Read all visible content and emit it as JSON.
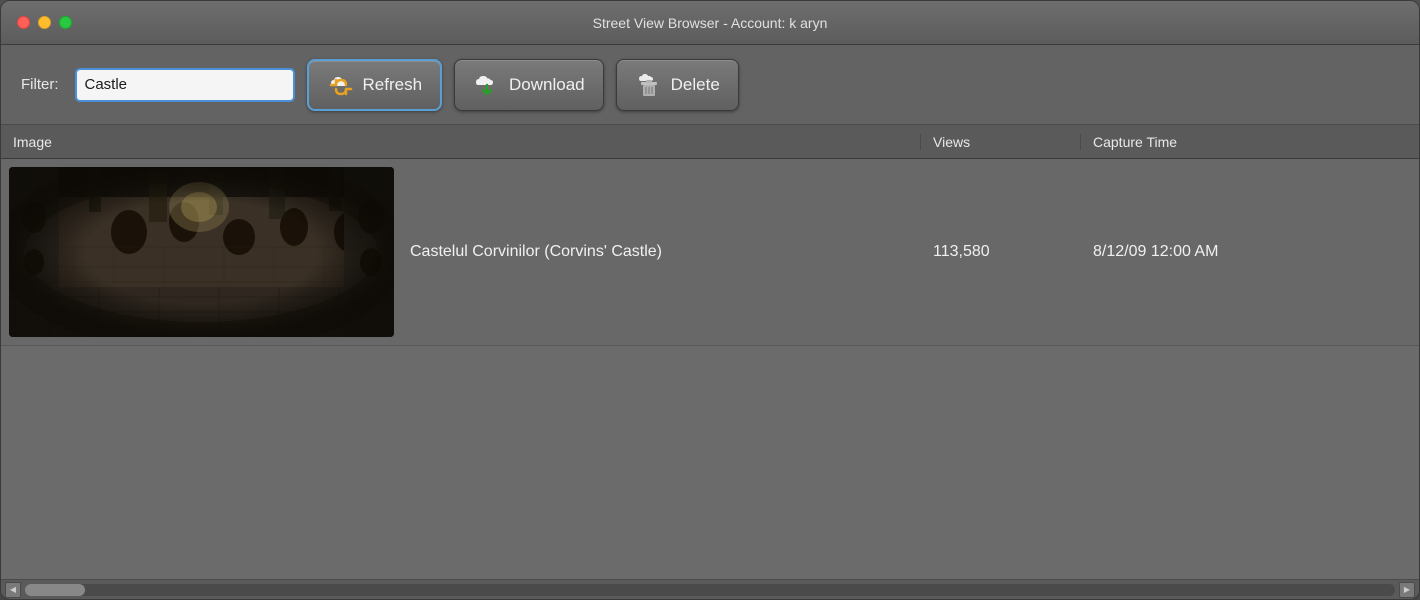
{
  "window": {
    "title": "Street View Browser - Account: k aryn"
  },
  "toolbar": {
    "filter_label": "Filter:",
    "filter_value": "Castle",
    "refresh_label": "Refresh",
    "download_label": "Download",
    "delete_label": "Delete"
  },
  "table": {
    "headers": [
      "Image",
      "Views",
      "Capture Time"
    ],
    "rows": [
      {
        "title": "Castelul Corvinilor (Corvins' Castle)",
        "views": "113,580",
        "capture_time": "8/12/09 12:00 AM"
      }
    ]
  },
  "scrollbar": {
    "left_arrow": "◀",
    "right_arrow": "▶"
  }
}
